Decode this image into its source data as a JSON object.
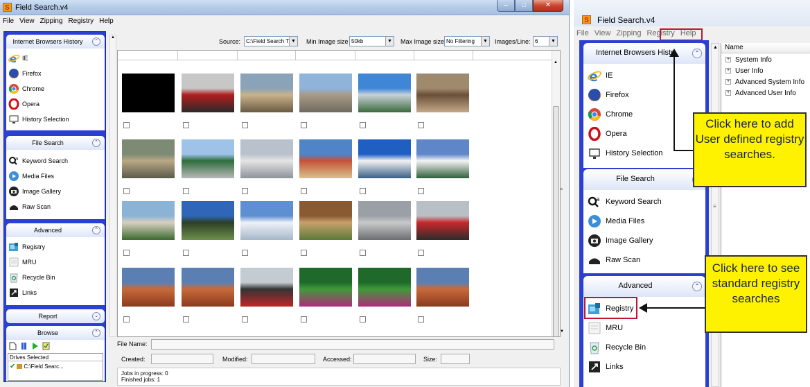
{
  "app": {
    "title": "Field Search.v4",
    "icon_letter": "S"
  },
  "menu": [
    "File",
    "View",
    "Zipping",
    "Registry",
    "Help"
  ],
  "sidebar": {
    "browsers": {
      "title": "Internet Browsers History",
      "items": [
        "IE",
        "Firefox",
        "Chrome",
        "Opera",
        "History Selection"
      ]
    },
    "file_search": {
      "title": "File Search",
      "items": [
        "Keyword Search",
        "Media Files",
        "Image Gallery",
        "Raw Scan"
      ]
    },
    "advanced": {
      "title": "Advanced",
      "items": [
        "Registry",
        "MRU",
        "Recycle Bin",
        "Links"
      ]
    },
    "report": {
      "title": "Report"
    },
    "browse": {
      "title": "Browse",
      "drives_header": "Drives Selected",
      "drive": "C:\\Field Searc..."
    }
  },
  "toolbar": {
    "source_label": "Source:",
    "source_value": "C:\\Field Search T‹",
    "min_label": "Min Image size",
    "min_value": "50kb",
    "max_label": "Max Image size",
    "max_value": "No Filtering",
    "per_line_label": "Images/Line:",
    "per_line_value": "6"
  },
  "details": {
    "file_name_label": "File Name:",
    "created_label": "Created:",
    "modified_label": "Modified:",
    "accessed_label": "Accessed:",
    "size_label": "Size:"
  },
  "jobs": {
    "in_progress": "Jobs in progress: 0",
    "finished": "Finished jobs: 1"
  },
  "right": {
    "tree_header": "Name",
    "tree_items": [
      "System Info",
      "User Info",
      "Advanced System Info",
      "Advanced User Info"
    ],
    "sidebar_browsers_title": "Internet Browsers Histo",
    "callout_top": "Click here to add User defined registry searches.",
    "callout_bottom": "Click here to see standard registry searches"
  },
  "colors": {
    "sidebar_blue": "#2c3fd3",
    "callout_yellow": "#fff200",
    "highlight_red": "#c0152f"
  }
}
